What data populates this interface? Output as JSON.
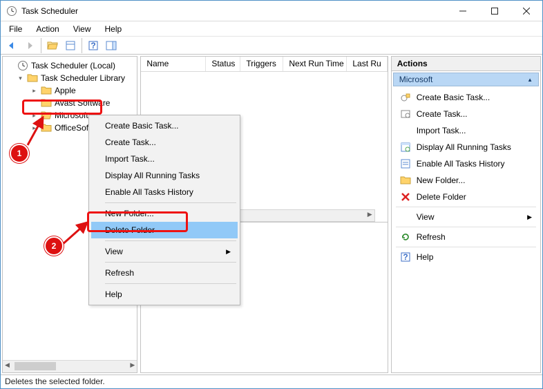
{
  "title": "Task Scheduler",
  "menubar": [
    "File",
    "Action",
    "View",
    "Help"
  ],
  "tree": {
    "root": "Task Scheduler (Local)",
    "library": "Task Scheduler Library",
    "items": [
      "Apple",
      "Avast Software",
      "Microsoft",
      "OfficeSoft"
    ]
  },
  "list_columns": [
    "Name",
    "Status",
    "Triggers",
    "Next Run Time",
    "Last Ru"
  ],
  "context_menu": [
    "Create Basic Task...",
    "Create Task...",
    "Import Task...",
    "Display All Running Tasks",
    "Enable All Tasks History",
    "New Folder...",
    "Delete Folder",
    "View",
    "Refresh",
    "Help"
  ],
  "actions": {
    "pane_title": "Actions",
    "header": "Microsoft",
    "items": [
      "Create Basic Task...",
      "Create Task...",
      "Import Task...",
      "Display All Running Tasks",
      "Enable All Tasks History",
      "New Folder...",
      "Delete Folder",
      "View",
      "Refresh",
      "Help"
    ]
  },
  "status_text": "Deletes the selected folder.",
  "highlight": {
    "tree_item_index": 2,
    "context_item_index": 6
  },
  "badges": [
    "1",
    "2"
  ]
}
